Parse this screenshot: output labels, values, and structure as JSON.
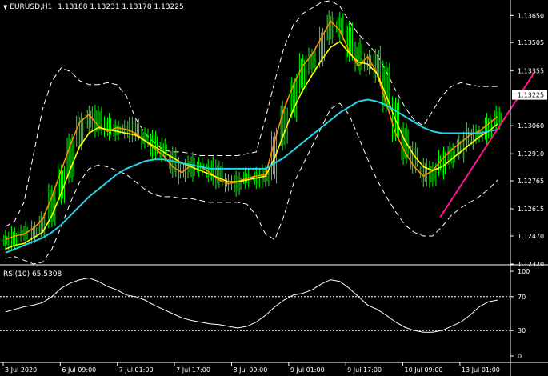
{
  "header": {
    "symbol": "EURUSD,H1",
    "ohlc": "1.13188 1.13231 1.13178 1.13225",
    "rsi_label": "RSI(10) 65.5308"
  },
  "colors": {
    "background": "#000000",
    "candles": "#00ff00",
    "ma_fast": "#ff8c00",
    "ma_mid": "#ffff00",
    "ma_slow": "#22d3ee",
    "bands": "#ffffff",
    "trendline": "#ff1493",
    "rsi_line": "#ffffff",
    "price_marker": "#ffffff"
  },
  "chart_data": {
    "type": "line",
    "price_axis": {
      "ticks": [
        "1.13650",
        "1.13505",
        "1.13355",
        "1.13060",
        "1.12910",
        "1.12765",
        "1.12615",
        "1.12470",
        "1.12320"
      ],
      "ylim": [
        1.1232,
        1.1372
      ],
      "current_price": "1.13225"
    },
    "rsi_axis": {
      "ticks": [
        "100",
        "70",
        "30",
        "0"
      ],
      "levels": [
        70,
        30
      ],
      "ylim": [
        0,
        100
      ],
      "current_value": 65.5308
    },
    "time_axis": {
      "labels": [
        "3 Jul 2020",
        "6 Jul 09:00",
        "7 Jul 01:00",
        "7 Jul 17:00",
        "8 Jul 09:00",
        "9 Jul 01:00",
        "9 Jul 17:00",
        "10 Jul 09:00",
        "13 Jul 01:00"
      ]
    },
    "series": [
      {
        "values": [
          1.1245,
          1.1247,
          1.1248,
          1.1251,
          1.1256,
          1.1268,
          1.1282,
          1.1296,
          1.1308,
          1.1312,
          1.1306,
          1.1303,
          1.1305,
          1.1304,
          1.1302,
          1.1298,
          1.1294,
          1.129,
          1.1284,
          1.1281,
          1.1285,
          1.1284,
          1.1281,
          1.1277,
          1.1275,
          1.1276,
          1.1278,
          1.1279,
          1.128,
          1.1298,
          1.1315,
          1.1328,
          1.1338,
          1.1344,
          1.1353,
          1.1362,
          1.1357,
          1.1346,
          1.1338,
          1.1343,
          1.1334,
          1.1318,
          1.1302,
          1.1292,
          1.1284,
          1.1279,
          1.1282,
          1.1288,
          1.1293,
          1.1297,
          1.1301,
          1.1303,
          1.1307,
          1.1311
        ]
      },
      {
        "values": [
          1.124,
          1.1242,
          1.1243,
          1.1246,
          1.1249,
          1.1258,
          1.127,
          1.1283,
          1.1295,
          1.1302,
          1.1305,
          1.1304,
          1.1303,
          1.1302,
          1.1301,
          1.1298,
          1.1295,
          1.1292,
          1.1289,
          1.1286,
          1.1284,
          1.1282,
          1.128,
          1.1278,
          1.1276,
          1.1276,
          1.1277,
          1.1278,
          1.1279,
          1.1289,
          1.1302,
          1.1315,
          1.1325,
          1.1333,
          1.1341,
          1.1348,
          1.1351,
          1.1345,
          1.134,
          1.1339,
          1.1334,
          1.1322,
          1.1309,
          1.1298,
          1.129,
          1.1284,
          1.1282,
          1.1284,
          1.1288,
          1.1292,
          1.1296,
          1.13,
          1.1303,
          1.1307
        ]
      },
      {
        "values": [
          1.1238,
          1.124,
          1.1242,
          1.1244,
          1.1246,
          1.1249,
          1.1253,
          1.1258,
          1.1263,
          1.1268,
          1.1272,
          1.1276,
          1.128,
          1.1283,
          1.1285,
          1.1287,
          1.1288,
          1.1288,
          1.1287,
          1.1286,
          1.1285,
          1.1284,
          1.1283,
          1.1283,
          1.1283,
          1.1283,
          1.1283,
          1.1283,
          1.1283,
          1.1286,
          1.1289,
          1.1293,
          1.1297,
          1.1301,
          1.1305,
          1.1309,
          1.1313,
          1.1316,
          1.1319,
          1.132,
          1.1319,
          1.1317,
          1.1314,
          1.1311,
          1.1308,
          1.1305,
          1.1303,
          1.1302,
          1.1302,
          1.1302,
          1.1302,
          1.1302,
          1.1303,
          1.1304
        ]
      }
    ],
    "bands": {
      "upper": [
        1.1252,
        1.1255,
        1.1265,
        1.129,
        1.1315,
        1.133,
        1.1337,
        1.1335,
        1.133,
        1.1328,
        1.1328,
        1.1329,
        1.1328,
        1.1322,
        1.131,
        1.1302,
        1.1297,
        1.1293,
        1.1292,
        1.1292,
        1.1291,
        1.129,
        1.129,
        1.129,
        1.129,
        1.129,
        1.1291,
        1.1292,
        1.131,
        1.133,
        1.1348,
        1.136,
        1.1366,
        1.1369,
        1.1372,
        1.1373,
        1.137,
        1.1362,
        1.1355,
        1.135,
        1.1344,
        1.1335,
        1.1325,
        1.1316,
        1.1309,
        1.1306,
        1.1314,
        1.1322,
        1.1327,
        1.1329,
        1.1328,
        1.1327,
        1.1327,
        1.1327
      ],
      "lower": [
        1.1235,
        1.1236,
        1.1234,
        1.1232,
        1.1233,
        1.124,
        1.1252,
        1.1265,
        1.1276,
        1.1283,
        1.1285,
        1.1284,
        1.1282,
        1.128,
        1.1276,
        1.1272,
        1.1269,
        1.1268,
        1.1268,
        1.1267,
        1.1267,
        1.1266,
        1.1265,
        1.1265,
        1.1265,
        1.1265,
        1.1264,
        1.1258,
        1.1248,
        1.1245,
        1.1258,
        1.1275,
        1.1285,
        1.1295,
        1.1305,
        1.1315,
        1.1318,
        1.1312,
        1.13,
        1.1288,
        1.1277,
        1.1268,
        1.126,
        1.1253,
        1.1249,
        1.1247,
        1.1247,
        1.1252,
        1.1258,
        1.1262,
        1.1265,
        1.1268,
        1.1272,
        1.1277
      ]
    },
    "trendline": {
      "from": [
        46.8,
        1.1257
      ],
      "to": [
        57.0,
        1.1335
      ]
    },
    "rsi": [
      52,
      55,
      58,
      60,
      63,
      70,
      80,
      86,
      90,
      92,
      88,
      82,
      78,
      72,
      70,
      66,
      60,
      55,
      50,
      45,
      42,
      40,
      38,
      37,
      35,
      33,
      35,
      40,
      48,
      58,
      66,
      72,
      74,
      78,
      85,
      90,
      88,
      80,
      70,
      60,
      55,
      48,
      40,
      34,
      30,
      28,
      28,
      30,
      35,
      40,
      48,
      58,
      64,
      66
    ]
  }
}
